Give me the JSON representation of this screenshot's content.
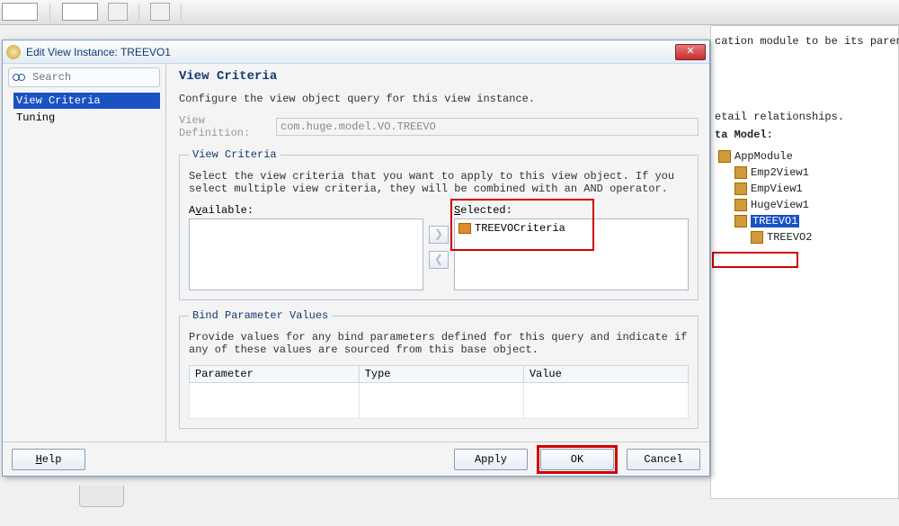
{
  "toolbar": {},
  "dialog": {
    "title": "Edit View Instance: TREEVO1",
    "search_placeholder": "Search",
    "nav": {
      "items": [
        "View Criteria",
        "Tuning"
      ],
      "selected": 0
    },
    "heading": "View Criteria",
    "description": "Configure the view object query for this view instance.",
    "view_def_label": "View Definition:",
    "view_def_value": "com.huge.model.VO.TREEVO",
    "criteria_fieldset": {
      "legend": "View Criteria",
      "hint": "Select the view criteria that you want to apply to this view object. If you select multiple view criteria, they will be combined with an AND operator.",
      "available_label_pre": "A",
      "available_label_ul": "v",
      "available_label_post": "ailable:",
      "selected_label_ul": "S",
      "selected_label_post": "elected:",
      "available_items": [],
      "selected_items": [
        "TREEVOCriteria"
      ]
    },
    "bind_fieldset": {
      "legend": "Bind Parameter Values",
      "hint": "Provide values for any bind parameters defined for this query and indicate if any of these values are sourced from this base object.",
      "columns": [
        "Parameter",
        "Type",
        "Value"
      ]
    },
    "buttons": {
      "help_ul": "H",
      "help_rest": "elp",
      "apply": "Apply",
      "ok": "OK",
      "cancel": "Cancel"
    }
  },
  "bg": {
    "line1": "cation module to be its parent in t",
    "line2": "etail relationships.",
    "model_label": "ta Model:",
    "tree": {
      "root": "AppModule",
      "children": [
        "Emp2View1",
        "EmpView1",
        "HugeView1",
        "TREEVO1"
      ],
      "grandchild": "TREEVO2",
      "selected": "TREEVO1"
    }
  }
}
